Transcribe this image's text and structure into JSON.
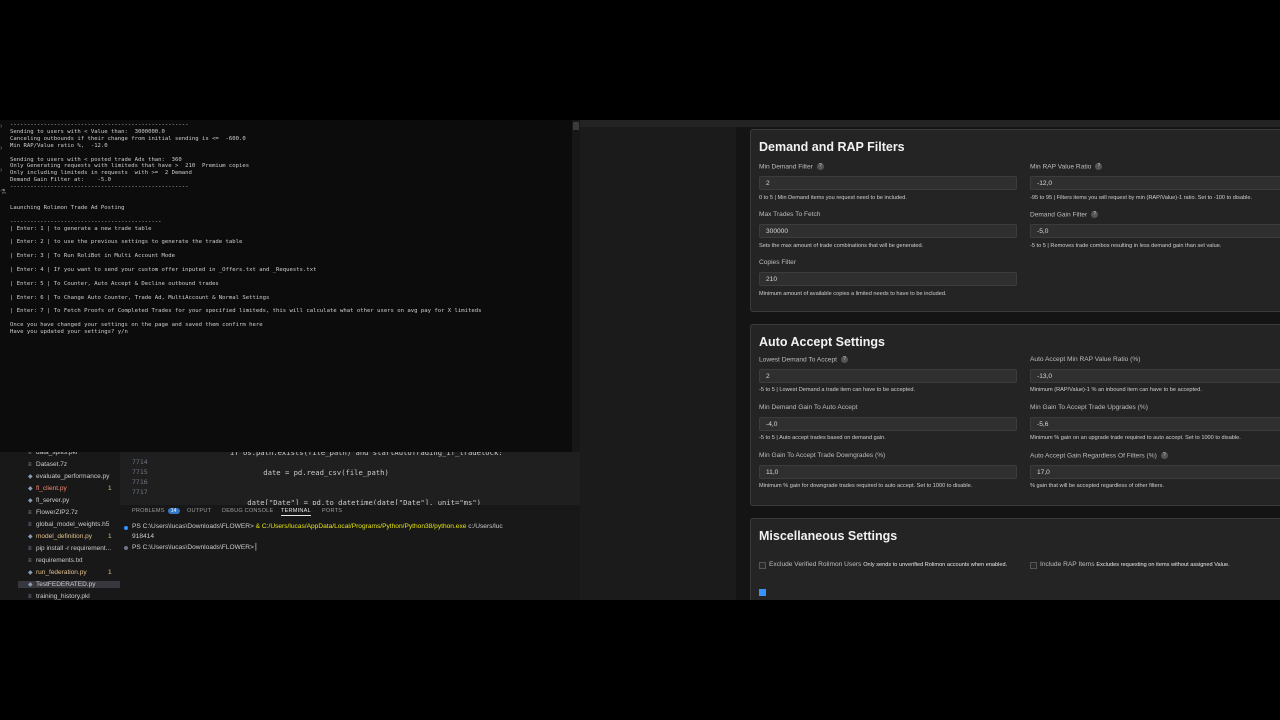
{
  "console": {
    "lines": [
      "-----------------------------------------------------",
      "Sending to users with < Value than:  3000000.0",
      "Canceling outbounds if their change from initial sending is <=  -600.0",
      "Min RAP/Value ratio %,  -12.0",
      "",
      "Sending to users with < posted trade Ads than:  360",
      "Only Generating requests with limiteds that have >  210  Premium copies",
      "Only including limiteds in requests  with >=  2 Demand",
      "Demand Gain Filter at:    -5.0",
      "-----------------------------------------------------",
      "",
      "",
      "Launching Rolimon Trade Ad Posting",
      "",
      "---------------------------------------------",
      "| Enter: 1 | to generate a new trade table",
      "",
      "| Enter: 2 | to use the previous settings to generate the trade table",
      "",
      "| Enter: 3 | To Run RoliBot in Multi Account Mode",
      "",
      "| Enter: 4 | If you want to send your custom offer inputed in _Offers.txt and _Requests.txt",
      "",
      "| Enter: 5 | To Counter, Auto Accept & Decline outbound trades",
      "",
      "| Enter: 6 | To Change Auto Counter, Trade Ad, MultiAccount & Normal Settings",
      "",
      "| Enter: 7 | To Fetch Proofs of Completed Trades for your specified limiteds, this will calculate what other users on avg pay for X limiteds",
      "",
      "Once you have changed your settings on the page and saved them confirm here",
      "Have you updated your settings? y/n"
    ]
  },
  "explorer": {
    "items": [
      {
        "name": "data_splits.pkl",
        "icon": "file-icon",
        "status": "",
        "badge": ""
      },
      {
        "name": "Dataset.7z",
        "icon": "file-icon",
        "status": "",
        "badge": ""
      },
      {
        "name": "evaluate_performance.py",
        "icon": "python-icon",
        "status": "",
        "badge": ""
      },
      {
        "name": "fl_client.py",
        "icon": "python-icon",
        "status": "err",
        "badge": "1"
      },
      {
        "name": "fl_server.py",
        "icon": "python-icon",
        "status": "",
        "badge": ""
      },
      {
        "name": "FlowerZIP2.7z",
        "icon": "file-icon",
        "status": "",
        "badge": ""
      },
      {
        "name": "global_model_weights.h5",
        "icon": "file-icon",
        "status": "",
        "badge": ""
      },
      {
        "name": "model_definition.py",
        "icon": "python-icon",
        "status": "mod",
        "badge": "1"
      },
      {
        "name": "pip install -r requirement...",
        "icon": "file-icon",
        "status": "",
        "badge": ""
      },
      {
        "name": "requirements.txt",
        "icon": "file-icon",
        "status": "",
        "badge": ""
      },
      {
        "name": "run_federation.py",
        "icon": "python-icon",
        "status": "mod",
        "badge": "1"
      },
      {
        "name": "TestFEDERATED.py",
        "icon": "python-icon",
        "status": "sel",
        "badge": ""
      },
      {
        "name": "training_history.pkl",
        "icon": "file-icon",
        "status": "",
        "badge": ""
      }
    ]
  },
  "editor": {
    "lines": [
      {
        "num": "",
        "code": "if os.path.exists(file_path) and startAutoTrading_if_tradelock:"
      },
      {
        "num": "7714",
        "code": ""
      },
      {
        "num": "7715",
        "code": "    date = pd.read_csv(file_path)"
      },
      {
        "num": "7716",
        "code": ""
      },
      {
        "num": "7717",
        "code": ""
      },
      {
        "num": "",
        "code": "    date[\"Date\"] = pd.to_datetime(date[\"Date\"], unit=\"ms\")"
      }
    ]
  },
  "panel": {
    "tabs": [
      "PROBLEMS",
      "OUTPUT",
      "DEBUG CONSOLE",
      "TERMINAL",
      "PORTS"
    ],
    "problems_count": "14",
    "active_tab": "TERMINAL"
  },
  "terminal": {
    "line1_prompt": "PS C:\\Users\\lucas\\Downloads\\FLOWER> ",
    "line1_amp": "& ",
    "line1_exe": "C:/Users/lucas/AppData/Local/Programs/Python/Python38/python.exe",
    "line1_rest": " c:/Users/luc",
    "line2": "918414",
    "line3": "PS C:\\Users\\lucas\\Downloads\\FLOWER> ▏"
  },
  "demand_rap": {
    "title": "Demand and RAP Filters",
    "min_demand": {
      "label": "Min Demand Filter",
      "value": "2",
      "desc": "0 to 5 | Min Demand items you request need to be included."
    },
    "min_rap": {
      "label": "Min RAP Value Ratio",
      "value": "-12,0",
      "desc": "-95 to 95 | Filters items you will request by min (RAP/Value)-1 ratio. Set to -100 to disable."
    },
    "max_trades": {
      "label": "Max Trades To Fetch",
      "value": "300000",
      "desc": "Sets the max amount of trade combinations that will be generated."
    },
    "demand_gain": {
      "label": "Demand Gain Filter",
      "value": "-5,0",
      "desc": "-5 to 5 | Removes trade combos resulting in less demand gain than set value."
    },
    "copies": {
      "label": "Copies Filter",
      "value": "210",
      "desc": "Minimum amount of available copies a limited needs to have to be included."
    }
  },
  "auto_accept": {
    "title": "Auto Accept Settings",
    "lowest_demand": {
      "label": "Lowest Demand To Accept",
      "value": "2",
      "desc": "-5 to 5 | Lowest Demand a trade item can have to be accepted."
    },
    "min_rap_ratio": {
      "label": "Auto Accept Min RAP Value Ratio (%)",
      "value": "-13,0",
      "desc": "Minimum (RAP/Value)-1 % an inbound item can have to be accepted."
    },
    "min_demand_gain": {
      "label": "Min Demand Gain To Auto Accept",
      "value": "-4,0",
      "desc": "-5 to 5 | Auto accept trades based on demand gain."
    },
    "min_gain_upgrades": {
      "label": "Min Gain To Accept Trade Upgrades (%)",
      "value": "-5,6",
      "desc": "Minimum % gain on an upgrade trade required to auto accept. Set to 1000 to disable."
    },
    "min_gain_downgrades": {
      "label": "Min Gain To Accept Trade Downgrades (%)",
      "value": "11,0",
      "desc": "Minimum % gain for downgrade trades required to auto accept. Set to 1000 to disable."
    },
    "gain_regardless": {
      "label": "Auto Accept Gain Regardless Of Filters (%)",
      "value": "17,0",
      "desc": "% gain that will be accepted regardless of other filters."
    }
  },
  "misc": {
    "title": "Miscellaneous Settings",
    "exclude_verified": {
      "label": "Exclude Verified Rolimon Users",
      "desc": "Only sends to unverified Rolimon accounts when enabled."
    },
    "include_rap": {
      "label": "Include RAP Items",
      "desc": "Excludes requesting on items without assigned Value."
    }
  },
  "colors": {
    "accent": "#3794ff",
    "card_bg": "#242424",
    "page_bg": "#141414"
  }
}
